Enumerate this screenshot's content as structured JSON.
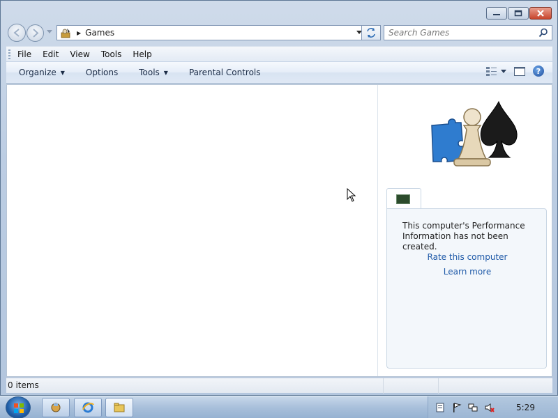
{
  "window": {
    "breadcrumb": "Games",
    "search_placeholder": "Search Games"
  },
  "menubar": {
    "items": [
      "File",
      "Edit",
      "View",
      "Tools",
      "Help"
    ]
  },
  "commandbar": {
    "organize": "Organize",
    "options": "Options",
    "tools": "Tools",
    "parental_controls": "Parental Controls"
  },
  "preview": {
    "perf_text": "This computer's Performance Information has not been created.",
    "rate_link": "Rate this computer",
    "learn_link": "Learn more"
  },
  "status": {
    "item_count": "0 items"
  },
  "taskbar": {
    "clock": "5:29"
  },
  "colors": {
    "link": "#1f5aa8",
    "close_button": "#c8452d"
  },
  "icons": [
    "minimize-icon",
    "maximize-icon",
    "close-icon",
    "back-icon",
    "forward-icon",
    "refresh-icon",
    "search-icon",
    "views-icon",
    "preview-pane-icon",
    "help-icon",
    "games-folder-icon",
    "start-orb-icon"
  ]
}
